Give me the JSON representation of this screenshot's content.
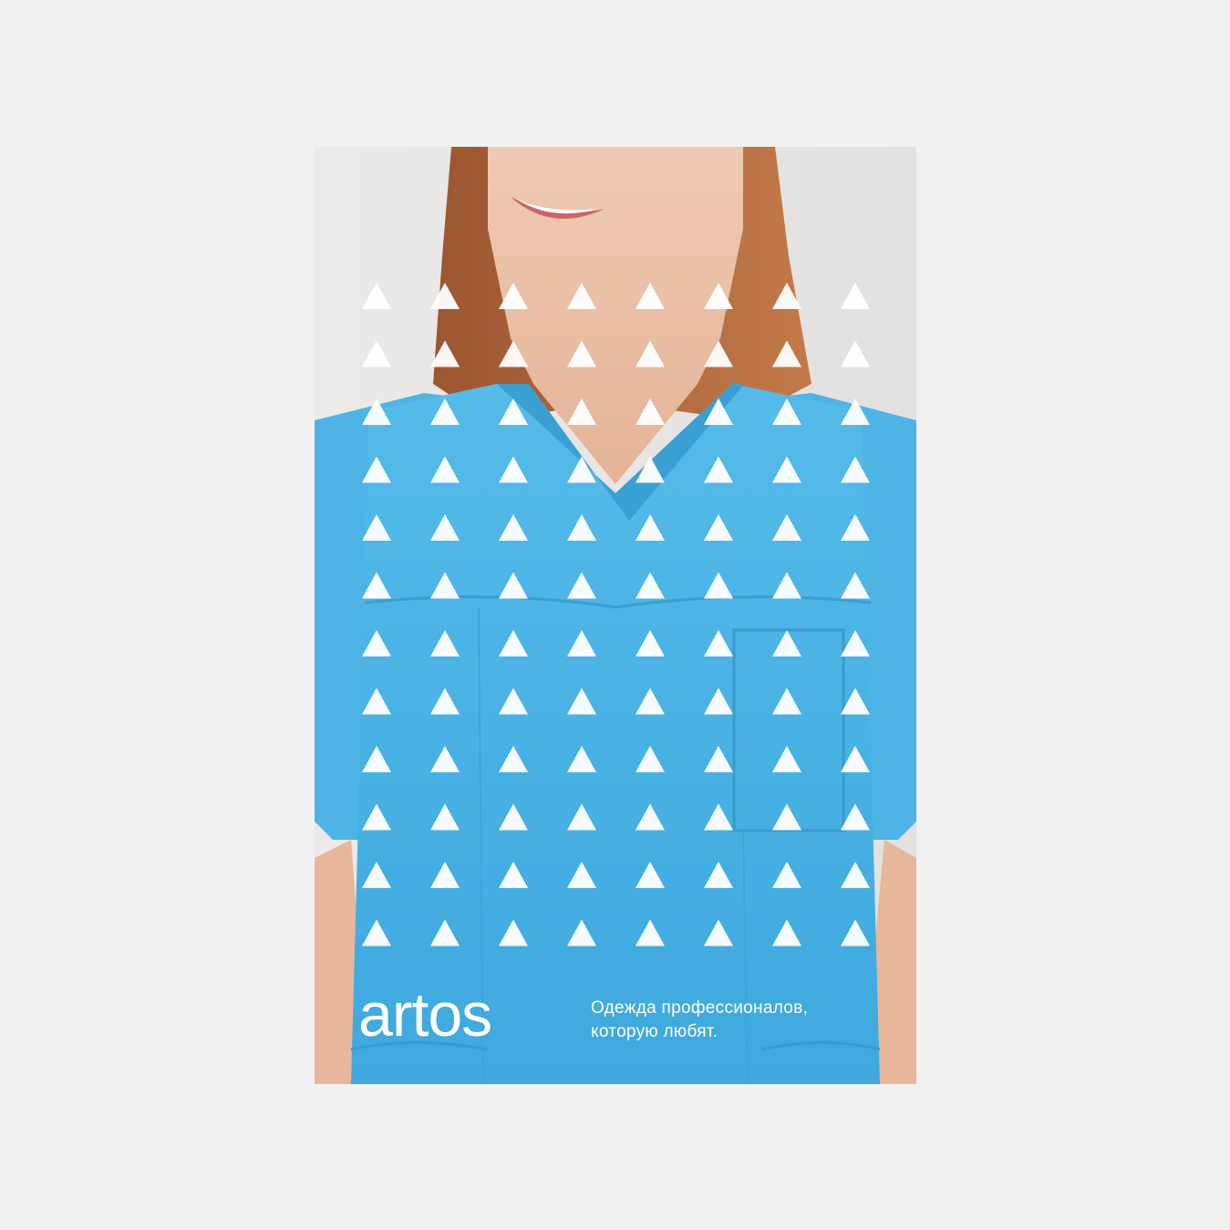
{
  "poster": {
    "brand": "artos",
    "tagline_line1": "Одежда профессионалов,",
    "tagline_line2": "которую любят.",
    "pattern": {
      "rows": 12,
      "cols": 8,
      "shape": "triangle"
    },
    "colors": {
      "background": "#f1f1f1",
      "scrub": "#4ab3e4",
      "scrub_shadow": "#3a9fd2",
      "hair": "#b56a3d",
      "skin": "#ecc3ab",
      "pattern": "#ffffff",
      "text": "#ffffff"
    }
  }
}
